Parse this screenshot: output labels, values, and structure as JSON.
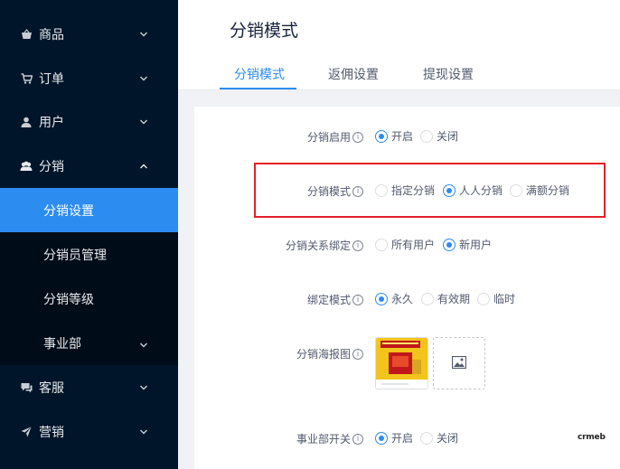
{
  "sidebar": {
    "items": [
      {
        "label": "商品",
        "icon": "basket-icon"
      },
      {
        "label": "订单",
        "icon": "cart-icon"
      },
      {
        "label": "用户",
        "icon": "user-icon"
      },
      {
        "label": "分销",
        "icon": "users-icon"
      },
      {
        "label": "客服",
        "icon": "chat-icon"
      },
      {
        "label": "营销",
        "icon": "send-icon"
      }
    ],
    "sub_items": [
      {
        "label": "分销设置"
      },
      {
        "label": "分销员管理"
      },
      {
        "label": "分销等级"
      },
      {
        "label": "事业部"
      }
    ],
    "active_color": "#2d8cf0",
    "bg_color": "#001529"
  },
  "header": {
    "title": "分销模式",
    "tabs": [
      {
        "label": "分销模式"
      },
      {
        "label": "返佣设置"
      },
      {
        "label": "提现设置"
      }
    ]
  },
  "form": {
    "enable": {
      "label": "分销启用",
      "options": [
        "开启",
        "关闭"
      ],
      "selected": "开启"
    },
    "mode": {
      "label": "分销模式",
      "options": [
        "指定分销",
        "人人分销",
        "满额分销"
      ],
      "selected": "人人分销"
    },
    "binding_scope": {
      "label": "分销关系绑定",
      "options": [
        "所有用户",
        "新用户"
      ],
      "selected": "新用户"
    },
    "binding_mode": {
      "label": "绑定模式",
      "options": [
        "永久",
        "有效期",
        "临时"
      ],
      "selected": "永久"
    },
    "poster": {
      "label": "分销海报图"
    },
    "division_switch": {
      "label": "事业部开关",
      "options": [
        "开启",
        "关闭"
      ],
      "selected": "开启"
    }
  },
  "info_glyph": "i",
  "watermark": "crmeb"
}
